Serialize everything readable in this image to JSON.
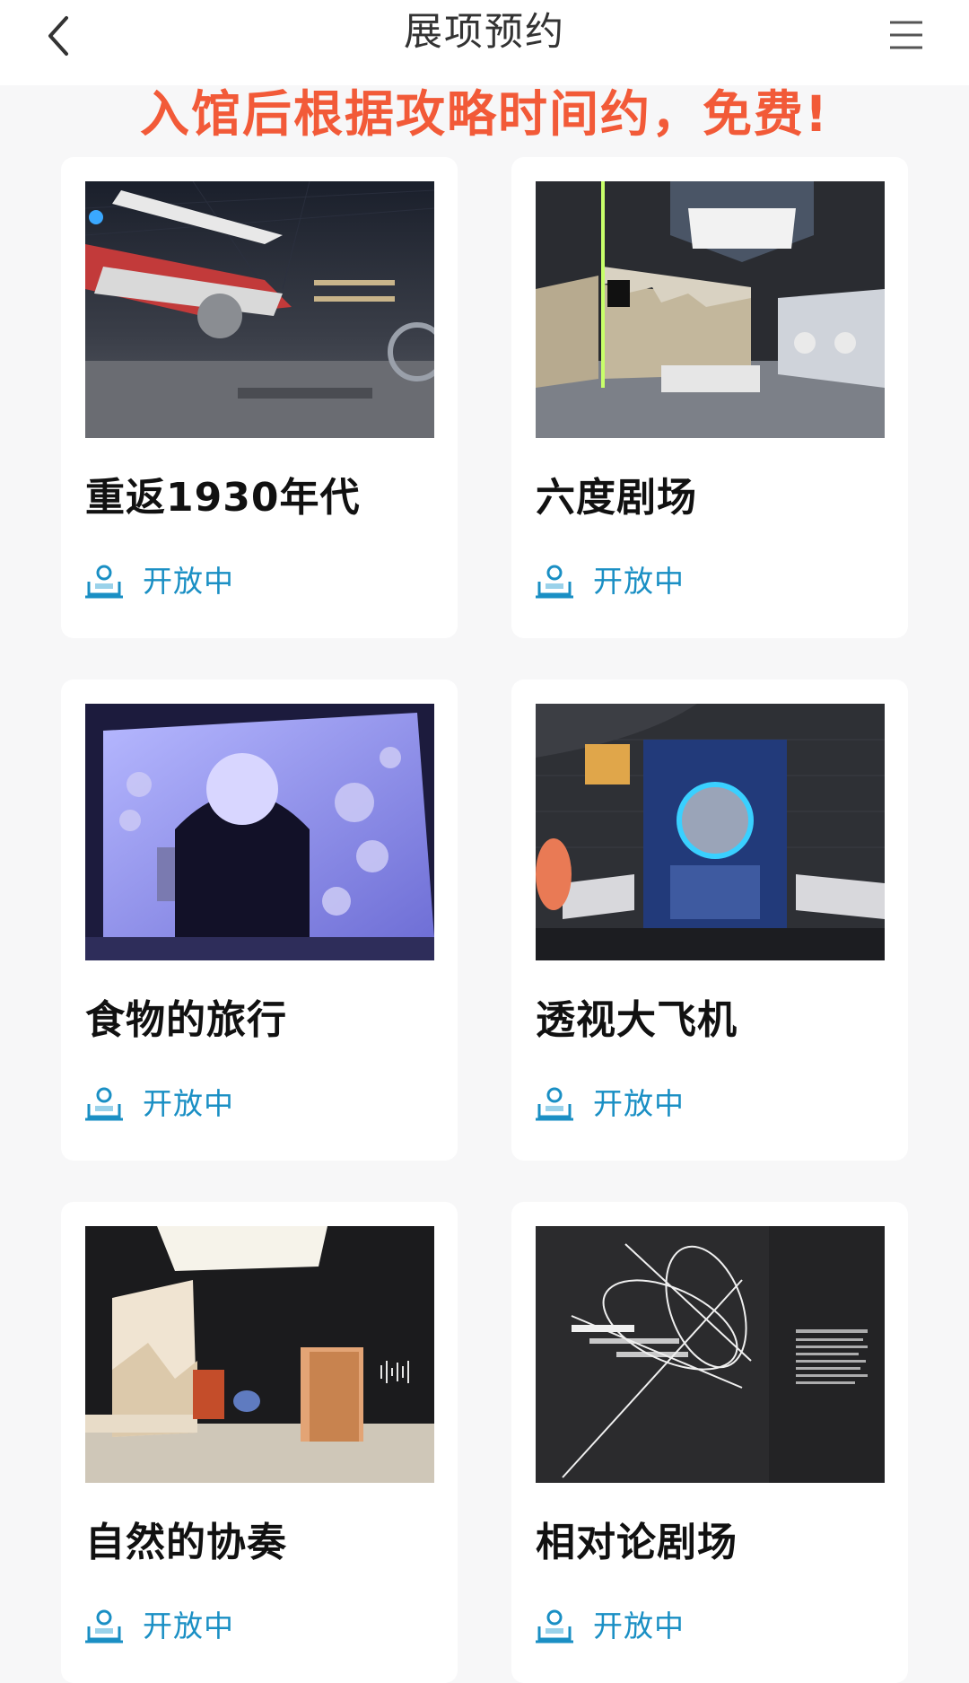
{
  "header": {
    "title": "展项预约"
  },
  "banner": {
    "text": "入馆后根据攻略时间约，免费!",
    "color": "#f25a38"
  },
  "colors": {
    "status": "#1a8fc4"
  },
  "exhibits": [
    {
      "name": "重返1930年代",
      "status": "开放中",
      "image": "aircraft-hall-photo"
    },
    {
      "name": "六度剧场",
      "status": "开放中",
      "image": "gallery-room-photo"
    },
    {
      "name": "食物的旅行",
      "status": "开放中",
      "image": "food-journey-arch-photo"
    },
    {
      "name": "透视大飞机",
      "status": "开放中",
      "image": "airplane-xray-exhibit-photo"
    },
    {
      "name": "自然的协奏",
      "status": "开放中",
      "image": "nature-concerto-room-photo"
    },
    {
      "name": "相对论剧场",
      "status": "开放中",
      "image": "relativity-theater-photo"
    }
  ]
}
